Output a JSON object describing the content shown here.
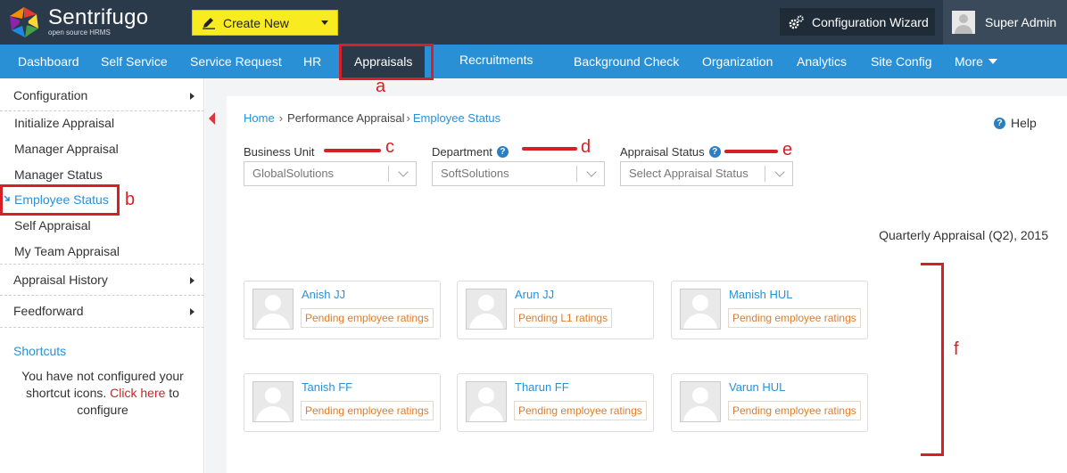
{
  "app": {
    "name": "Sentrifugo",
    "tagline": "open source HRMS"
  },
  "topbar": {
    "create_new": "Create New",
    "config_wizard": "Configuration Wizard",
    "user": "Super Admin"
  },
  "nav": {
    "items": [
      "Dashboard",
      "Self Service",
      "Service Request",
      "HR",
      "Appraisals",
      "Recruitments",
      "Background Check",
      "Organization",
      "Analytics",
      "Site Config",
      "More"
    ],
    "active": "Appraisals"
  },
  "sidebar": {
    "configuration": "Configuration",
    "items": [
      "Initialize Appraisal",
      "Manager Appraisal",
      "Manager Status",
      "Employee Status",
      "Self Appraisal",
      "My Team Appraisal"
    ],
    "active": "Employee Status",
    "appraisal_history": "Appraisal History",
    "feedforward": "Feedforward",
    "shortcuts_title": "Shortcuts",
    "shortcuts_text_1": "You have not configured your shortcut icons.",
    "shortcuts_link": "Click here",
    "shortcuts_text_2": "to configure"
  },
  "breadcrumb": {
    "home": "Home",
    "parent": "Performance Appraisal",
    "current": "Employee Status"
  },
  "help": "Help",
  "filters": {
    "business_unit": {
      "label": "Business Unit",
      "value": "GlobalSolutions"
    },
    "department": {
      "label": "Department",
      "value": "SoftSolutions"
    },
    "appraisal_status": {
      "label": "Appraisal Status",
      "placeholder": "Select Appraisal Status"
    }
  },
  "appraisal_title": "Quarterly Appraisal (Q2), 2015",
  "employees": [
    {
      "name": "Anish JJ",
      "status": "Pending employee ratings"
    },
    {
      "name": "Arun JJ",
      "status": "Pending L1 ratings"
    },
    {
      "name": "Manish HUL",
      "status": "Pending employee ratings"
    },
    {
      "name": "Tanish FF",
      "status": "Pending employee ratings"
    },
    {
      "name": "Tharun FF",
      "status": "Pending employee ratings"
    },
    {
      "name": "Varun HUL",
      "status": "Pending employee ratings"
    }
  ],
  "annotations": {
    "a": "a",
    "b": "b",
    "c": "c",
    "d": "d",
    "e": "e",
    "f": "f"
  },
  "colors": {
    "topbar": "#2b3a4a",
    "navbar": "#2a90d6",
    "create_new": "#f8ec21",
    "link": "#2a90d6",
    "status": "#e07c2a",
    "annotation": "#d71f26"
  }
}
